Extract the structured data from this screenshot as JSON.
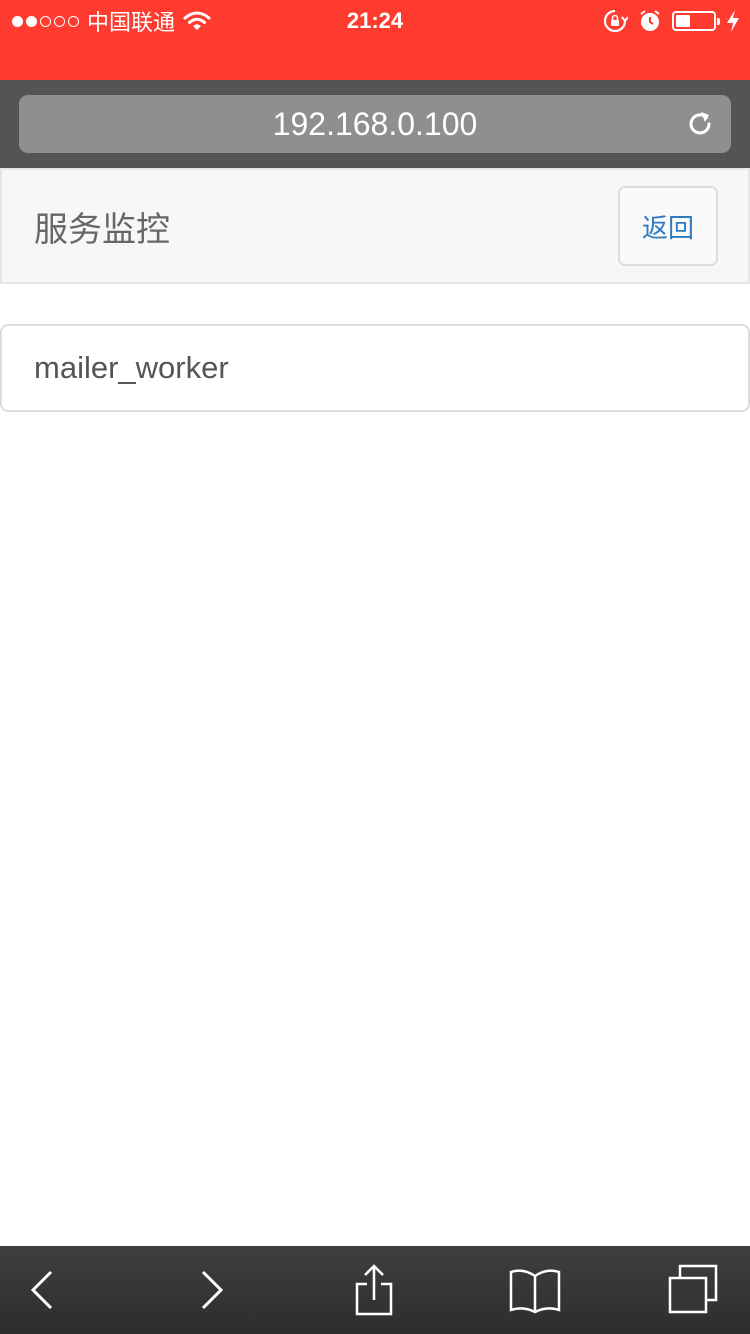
{
  "status_bar": {
    "signal_dots_on": 2,
    "signal_dots_total": 5,
    "carrier": "中国联通",
    "time": "21:24",
    "battery_level": 0.4,
    "color": "#ff3b30"
  },
  "browser": {
    "url": "192.168.0.100"
  },
  "header": {
    "title": "服务监控",
    "back_label": "返回",
    "back_color": "#2f7bbf"
  },
  "services": [
    {
      "name": "mailer_worker"
    }
  ],
  "toolbar": {
    "icons": [
      "back-arrow-icon",
      "forward-arrow-icon",
      "share-icon",
      "bookmarks-icon",
      "tabs-icon"
    ]
  }
}
